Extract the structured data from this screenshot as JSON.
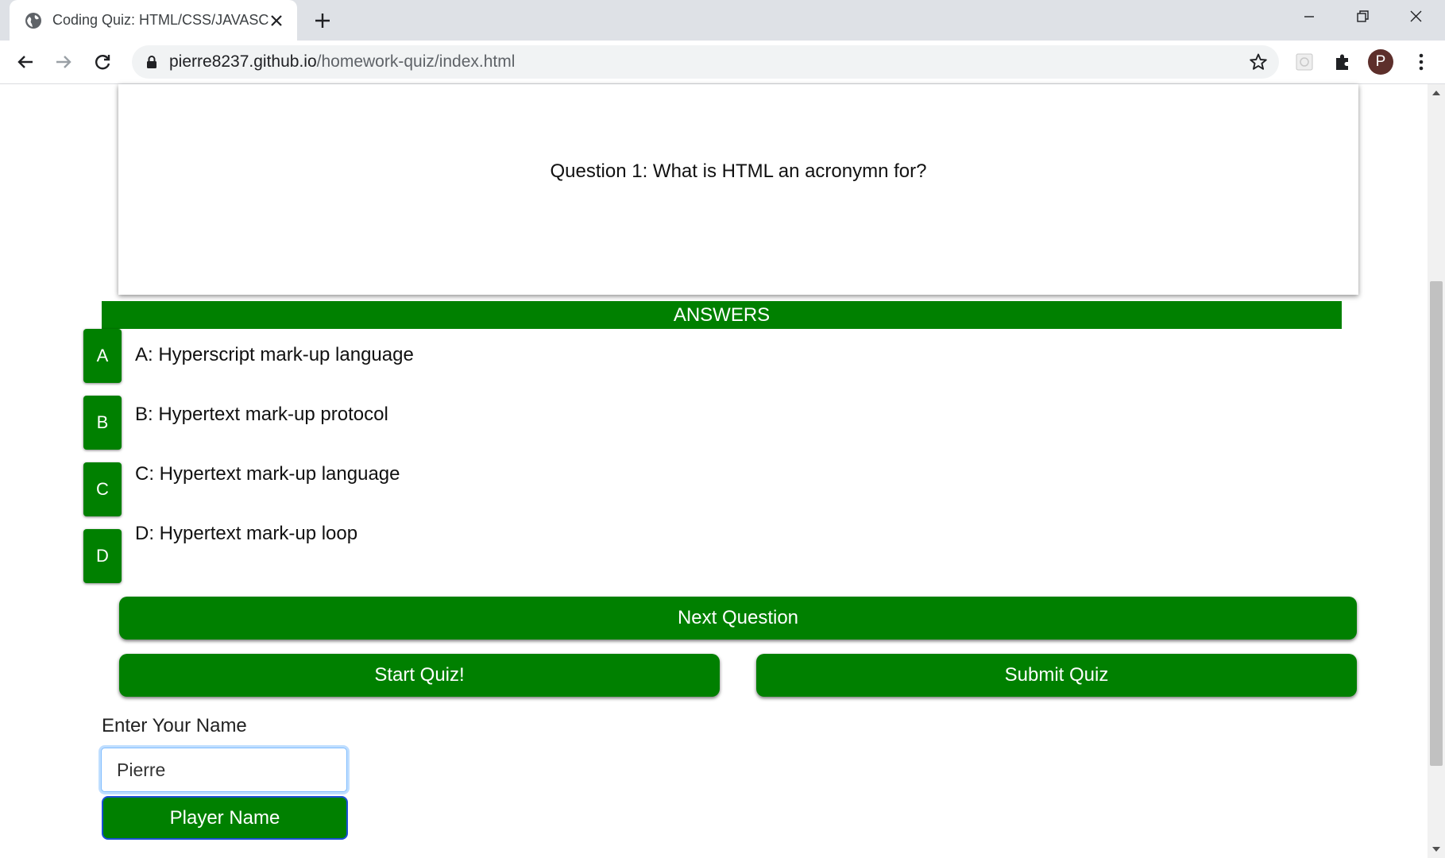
{
  "browser": {
    "tab_title": "Coding Quiz: HTML/CSS/JAVASCRIPT",
    "url_host": "pierre8237.github.io",
    "url_path": "/homework-quiz/index.html",
    "avatar_letter": "P"
  },
  "quiz": {
    "question": "Question 1: What is HTML an acronymn for?",
    "answers_header": "ANSWERS",
    "answers": [
      {
        "letter": "A",
        "text": "A: Hyperscript mark-up language"
      },
      {
        "letter": "B",
        "text": "B: Hypertext mark-up protocol"
      },
      {
        "letter": "C",
        "text": "C: Hypertext mark-up language"
      },
      {
        "letter": "D",
        "text": "D: Hypertext mark-up loop"
      }
    ],
    "next_label": "Next Question",
    "start_label": "Start Quiz!",
    "submit_label": "Submit Quiz"
  },
  "player": {
    "label": "Enter Your Name",
    "name_value": "Pierre",
    "button_label": "Player Name"
  },
  "colors": {
    "accent": "#008000",
    "focus_border": "#80bdff"
  },
  "icons": [
    "globe-icon",
    "close-icon",
    "plus-icon",
    "minimize-icon",
    "restore-icon",
    "window-close-icon",
    "back-arrow-icon",
    "forward-arrow-icon",
    "reload-icon",
    "lock-icon",
    "star-icon",
    "extension-icon",
    "puzzle-icon",
    "more-vert-icon"
  ]
}
